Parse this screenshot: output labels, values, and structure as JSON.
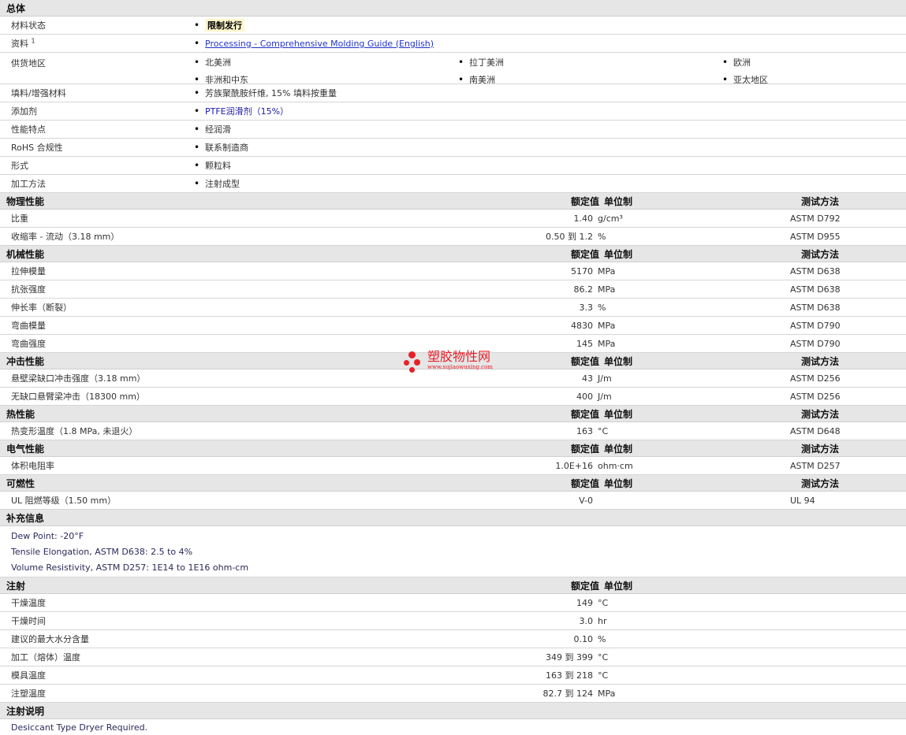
{
  "general": {
    "title": "总体",
    "material_status": {
      "label": "材料状态",
      "value": "限制发行"
    },
    "literature": {
      "label": "资料",
      "sup": "1",
      "value": "Processing - Comprehensive Molding Guide (English)"
    },
    "availability": {
      "label": "供货地区",
      "regions": [
        "北美洲",
        "拉丁美洲",
        "欧洲",
        "非洲和中东",
        "南美洲",
        "亚太地区"
      ]
    },
    "rows": [
      {
        "label": "填料/增强材料",
        "value": "芳族聚酰胺纤维, 15% 填料按重量"
      },
      {
        "label": "添加剂",
        "value": "PTFE润滑剂（15%）"
      },
      {
        "label": "性能特点",
        "value": "经润滑"
      },
      {
        "label": "RoHS 合规性",
        "value": "联系制造商"
      },
      {
        "label": "形式",
        "value": "颗粒料"
      },
      {
        "label": "加工方法",
        "value": "注射成型"
      }
    ]
  },
  "headers": {
    "nominal": "额定值",
    "unit": "单位制",
    "test": "测试方法"
  },
  "physical": {
    "title": "物理性能",
    "rows": [
      {
        "name": "比重",
        "nominal": "1.40",
        "unit": "g/cm³",
        "test": "ASTM D792"
      },
      {
        "name": "收缩率  - 流动（3.18 mm）",
        "nominal": "0.50 到  1.2",
        "unit": "%",
        "test": "ASTM D955"
      }
    ]
  },
  "mechanical": {
    "title": "机械性能",
    "rows": [
      {
        "name": "拉伸模量",
        "nominal": "5170",
        "unit": "MPa",
        "test": "ASTM D638"
      },
      {
        "name": "抗张强度",
        "nominal": "86.2",
        "unit": "MPa",
        "test": "ASTM D638"
      },
      {
        "name": "伸长率（断裂）",
        "nominal": "3.3",
        "unit": "%",
        "test": "ASTM D638"
      },
      {
        "name": "弯曲模量",
        "nominal": "4830",
        "unit": "MPa",
        "test": "ASTM D790"
      },
      {
        "name": "弯曲强度",
        "nominal": "145",
        "unit": "MPa",
        "test": "ASTM D790"
      }
    ]
  },
  "impact": {
    "title": "冲击性能",
    "rows": [
      {
        "name": "悬壁梁缺口冲击强度（3.18 mm）",
        "nominal": "43",
        "unit": "J/m",
        "test": "ASTM D256"
      },
      {
        "name": "无缺口悬臂梁冲击（18300 mm）",
        "nominal": "400",
        "unit": "J/m",
        "test": "ASTM D256"
      }
    ]
  },
  "thermal": {
    "title": "热性能",
    "rows": [
      {
        "name": "热变形温度（1.8 MPa, 未退火）",
        "nominal": "163",
        "unit": "°C",
        "test": "ASTM D648"
      }
    ]
  },
  "electrical": {
    "title": "电气性能",
    "rows": [
      {
        "name": "体积电阻率",
        "nominal": "1.0E+16",
        "unit": "ohm·cm",
        "test": "ASTM D257"
      }
    ]
  },
  "flammability": {
    "title": "可燃性",
    "rows": [
      {
        "name": "UL 阻燃等级（1.50 mm）",
        "nominal": "V-0",
        "unit": "",
        "test": "UL 94"
      }
    ]
  },
  "supplemental": {
    "title": "补充信息",
    "notes": [
      "Dew Point: -20°F",
      "Tensile Elongation, ASTM D638: 2.5 to 4%",
      "Volume Resistivity, ASTM D257: 1E14 to 1E16 ohm-cm"
    ]
  },
  "injection": {
    "title": "注射",
    "rows": [
      {
        "name": "干燥温度",
        "nominal": "149",
        "unit": "°C"
      },
      {
        "name": "干燥时间",
        "nominal": "3.0",
        "unit": "hr"
      },
      {
        "name": "建议的最大水分含量",
        "nominal": "0.10",
        "unit": "%"
      },
      {
        "name": "加工（熔体）温度",
        "nominal": "349 到  399",
        "unit": "°C"
      },
      {
        "name": "模具温度",
        "nominal": "163 到  218",
        "unit": "°C"
      },
      {
        "name": "注塑温度",
        "nominal": "82.7 到  124",
        "unit": "MPa"
      }
    ]
  },
  "injection_notes": {
    "title": "注射说明",
    "notes": [
      "Desiccant Type Dryer Required."
    ]
  },
  "watermark": {
    "name": "塑胶物性网",
    "url": "www.sujiaowuxing.com"
  }
}
